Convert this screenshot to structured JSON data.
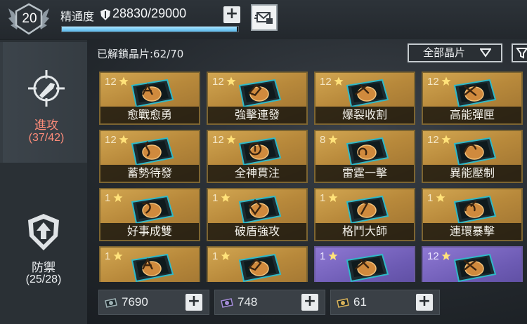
{
  "header": {
    "level": "20",
    "proficiency_label": "精通度",
    "proficiency_value": "28830/29000",
    "proficiency_progress": 0.994,
    "plus_icon": "plus-icon",
    "mail_icon": "mail-icon"
  },
  "sidebar": {
    "items": [
      {
        "label": "進攻",
        "count": "(37/42)",
        "icon": "attack-crosshair-icon",
        "selected": true
      },
      {
        "label": "防禦",
        "count": "(25/28)",
        "icon": "defense-shield-icon",
        "selected": false
      }
    ]
  },
  "main": {
    "unlocked_text": "已解鎖晶片:62/70",
    "filter_label": "全部晶片",
    "filter_icon": "funnel-icon"
  },
  "cards": [
    {
      "level": "12",
      "name": "愈戰愈勇",
      "rarity": "gold"
    },
    {
      "level": "12",
      "name": "強擊連發",
      "rarity": "gold"
    },
    {
      "level": "12",
      "name": "爆裂收割",
      "rarity": "gold"
    },
    {
      "level": "12",
      "name": "高能彈匣",
      "rarity": "gold"
    },
    {
      "level": "12",
      "name": "蓄勢待發",
      "rarity": "gold"
    },
    {
      "level": "12",
      "name": "全神貫注",
      "rarity": "gold"
    },
    {
      "level": "8",
      "name": "雷霆一擊",
      "rarity": "gold"
    },
    {
      "level": "12",
      "name": "異能壓制",
      "rarity": "gold"
    },
    {
      "level": "1",
      "name": "好事成雙",
      "rarity": "gold"
    },
    {
      "level": "1",
      "name": "破盾強攻",
      "rarity": "gold"
    },
    {
      "level": "1",
      "name": "格鬥大師",
      "rarity": "gold"
    },
    {
      "level": "1",
      "name": "連環暴擊",
      "rarity": "gold"
    },
    {
      "level": "1",
      "name": "",
      "rarity": "gold"
    },
    {
      "level": "1",
      "name": "",
      "rarity": "gold"
    },
    {
      "level": "1",
      "name": "",
      "rarity": "purple"
    },
    {
      "level": "12",
      "name": "",
      "rarity": "purple"
    }
  ],
  "resources": [
    {
      "value": "7690",
      "icon": "chip-material-gray-icon",
      "color": "#9fb2b5"
    },
    {
      "value": "748",
      "icon": "chip-material-purple-icon",
      "color": "#a58cd8"
    },
    {
      "value": "61",
      "icon": "chip-material-gold-icon",
      "color": "#d8b25a"
    }
  ],
  "colors": {
    "accent_cyan": "#58b7ea",
    "attack_red": "#ff8c7a",
    "gold_card": "#c0913f",
    "purple_card": "#7a66c2"
  }
}
